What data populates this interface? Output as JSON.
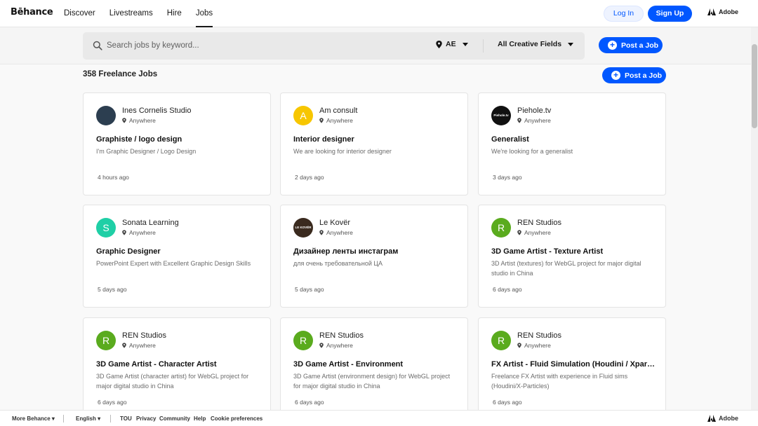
{
  "nav": {
    "logo": "Bēhance",
    "links": [
      "Discover",
      "Livestreams",
      "Hire",
      "Jobs"
    ],
    "login": "Log In",
    "signup": "Sign Up",
    "adobe": "Adobe"
  },
  "search": {
    "placeholder": "Search jobs by keyword...",
    "location": "AE",
    "fields": "All Creative Fields",
    "post_job": "Post a Job"
  },
  "results": {
    "count": "358 Freelance Jobs",
    "post_job": "Post a Job"
  },
  "jobs": [
    {
      "company": "Ines Cornelis Studio",
      "location": "Anywhere",
      "title": "Graphiste / logo design",
      "desc": "I'm Graphic Designer / Logo Design",
      "age": "4 hours ago",
      "avatar": "",
      "avatar_color": "#2c3e50"
    },
    {
      "company": "Am consult",
      "location": "Anywhere",
      "title": "Interior designer",
      "desc": "We are looking for interior designer",
      "age": "2 days ago",
      "avatar": "A",
      "avatar_color": "#f7c600"
    },
    {
      "company": "Piehole.tv",
      "location": "Anywhere",
      "title": "Generalist",
      "desc": "We're looking for a generalist",
      "age": "3 days ago",
      "avatar": "Piehole.tv",
      "avatar_color": "#111111"
    },
    {
      "company": "Sonata Learning",
      "location": "Anywhere",
      "title": "Graphic Designer",
      "desc": "PowerPoint Expert with Excellent Graphic Design Skills",
      "age": "5 days ago",
      "avatar": "S",
      "avatar_color": "#1fcfa6"
    },
    {
      "company": "Le Kovër",
      "location": "Anywhere",
      "title": "Дизайнер ленты инстаграм",
      "desc": "для очень требовательной ЦА",
      "age": "5 days ago",
      "avatar": "LE KOVËR",
      "avatar_color": "#3a2a1e"
    },
    {
      "company": "REN Studios",
      "location": "Anywhere",
      "title": "3D Game Artist - Texture Artist",
      "desc": "3D Artist (textures) for WebGL project for major digital studio in China",
      "age": "6 days ago",
      "avatar": "R",
      "avatar_color": "#5aab1e"
    },
    {
      "company": "REN Studios",
      "location": "Anywhere",
      "title": "3D Game Artist - Character Artist",
      "desc": "3D Game Artist (character artist) for WebGL project for major digital studio in China",
      "age": "6 days ago",
      "avatar": "R",
      "avatar_color": "#5aab1e"
    },
    {
      "company": "REN Studios",
      "location": "Anywhere",
      "title": "3D Game Artist - Environment",
      "desc": "3D Game Artist (environment design) for WebGL project for major digital studio in China",
      "age": "6 days ago",
      "avatar": "R",
      "avatar_color": "#5aab1e"
    },
    {
      "company": "REN Studios",
      "location": "Anywhere",
      "title": "FX Artist - Fluid Simulation (Houdini / Xparticles)",
      "desc": "Freelance FX Artist with experience in Fluid sims (Houdini/X-Particles)",
      "age": "6 days ago",
      "avatar": "R",
      "avatar_color": "#5aab1e"
    }
  ],
  "footer": {
    "more": "More Behance ▾",
    "language": "English ▾",
    "links": [
      "TOU",
      "Privacy",
      "Community",
      "Help",
      "Cookie preferences"
    ],
    "adobe": "Adobe"
  },
  "colors": {
    "accent": "#0057ff"
  }
}
